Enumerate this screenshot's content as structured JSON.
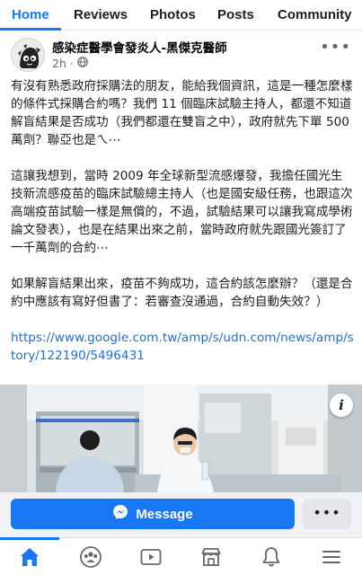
{
  "tabs": [
    {
      "label": "Home",
      "active": true
    },
    {
      "label": "Reviews",
      "active": false
    },
    {
      "label": "Photos",
      "active": false
    },
    {
      "label": "Posts",
      "active": false
    },
    {
      "label": "Community",
      "active": false
    }
  ],
  "post": {
    "page_name": "感染症醫學會發炎人-黑傑克醫師",
    "time": "2h",
    "privacy_icon": "globe-icon",
    "paragraphs": [
      "有沒有熟悉政府採購法的朋友，能給我個資訊，這是一種怎麼樣的條件式採購合約嗎？我們 11 個臨床試驗主持人，都還不知道解盲結果是否成功（我們都還在雙盲之中），政府就先下單 500 萬劑？聯亞也是ㄟ⋯",
      "這讓我想到，當時 2009 年全球新型流感爆發，我擔任國光生技新流感疫苗的臨床試驗總主持人（也是國安級任務，也跟這次高端疫苗試驗一樣是無償的，不過，試驗結果可以讓我寫成學術論文發表），也是在結果出來之前，當時政府就先跟國光簽訂了一千萬劑的合約⋯",
      "如果解盲結果出來，疫苗不夠成功，這合約該怎麼辦？（還是合約中應該有寫好但書了：若審查沒通過，合約自動失效？）"
    ],
    "link": "https://www.google.com.tw/amp/s/udn.com/news/amp/story/122190/5496431"
  },
  "message_bar": {
    "message_label": "Message",
    "more_label": "•••"
  },
  "bottom_nav": [
    "home-icon",
    "groups-icon",
    "watch-icon",
    "marketplace-icon",
    "notifications-icon",
    "menu-icon"
  ],
  "colors": {
    "accent": "#1877f2",
    "link": "#216fdb",
    "secondary_text": "#65676b"
  }
}
